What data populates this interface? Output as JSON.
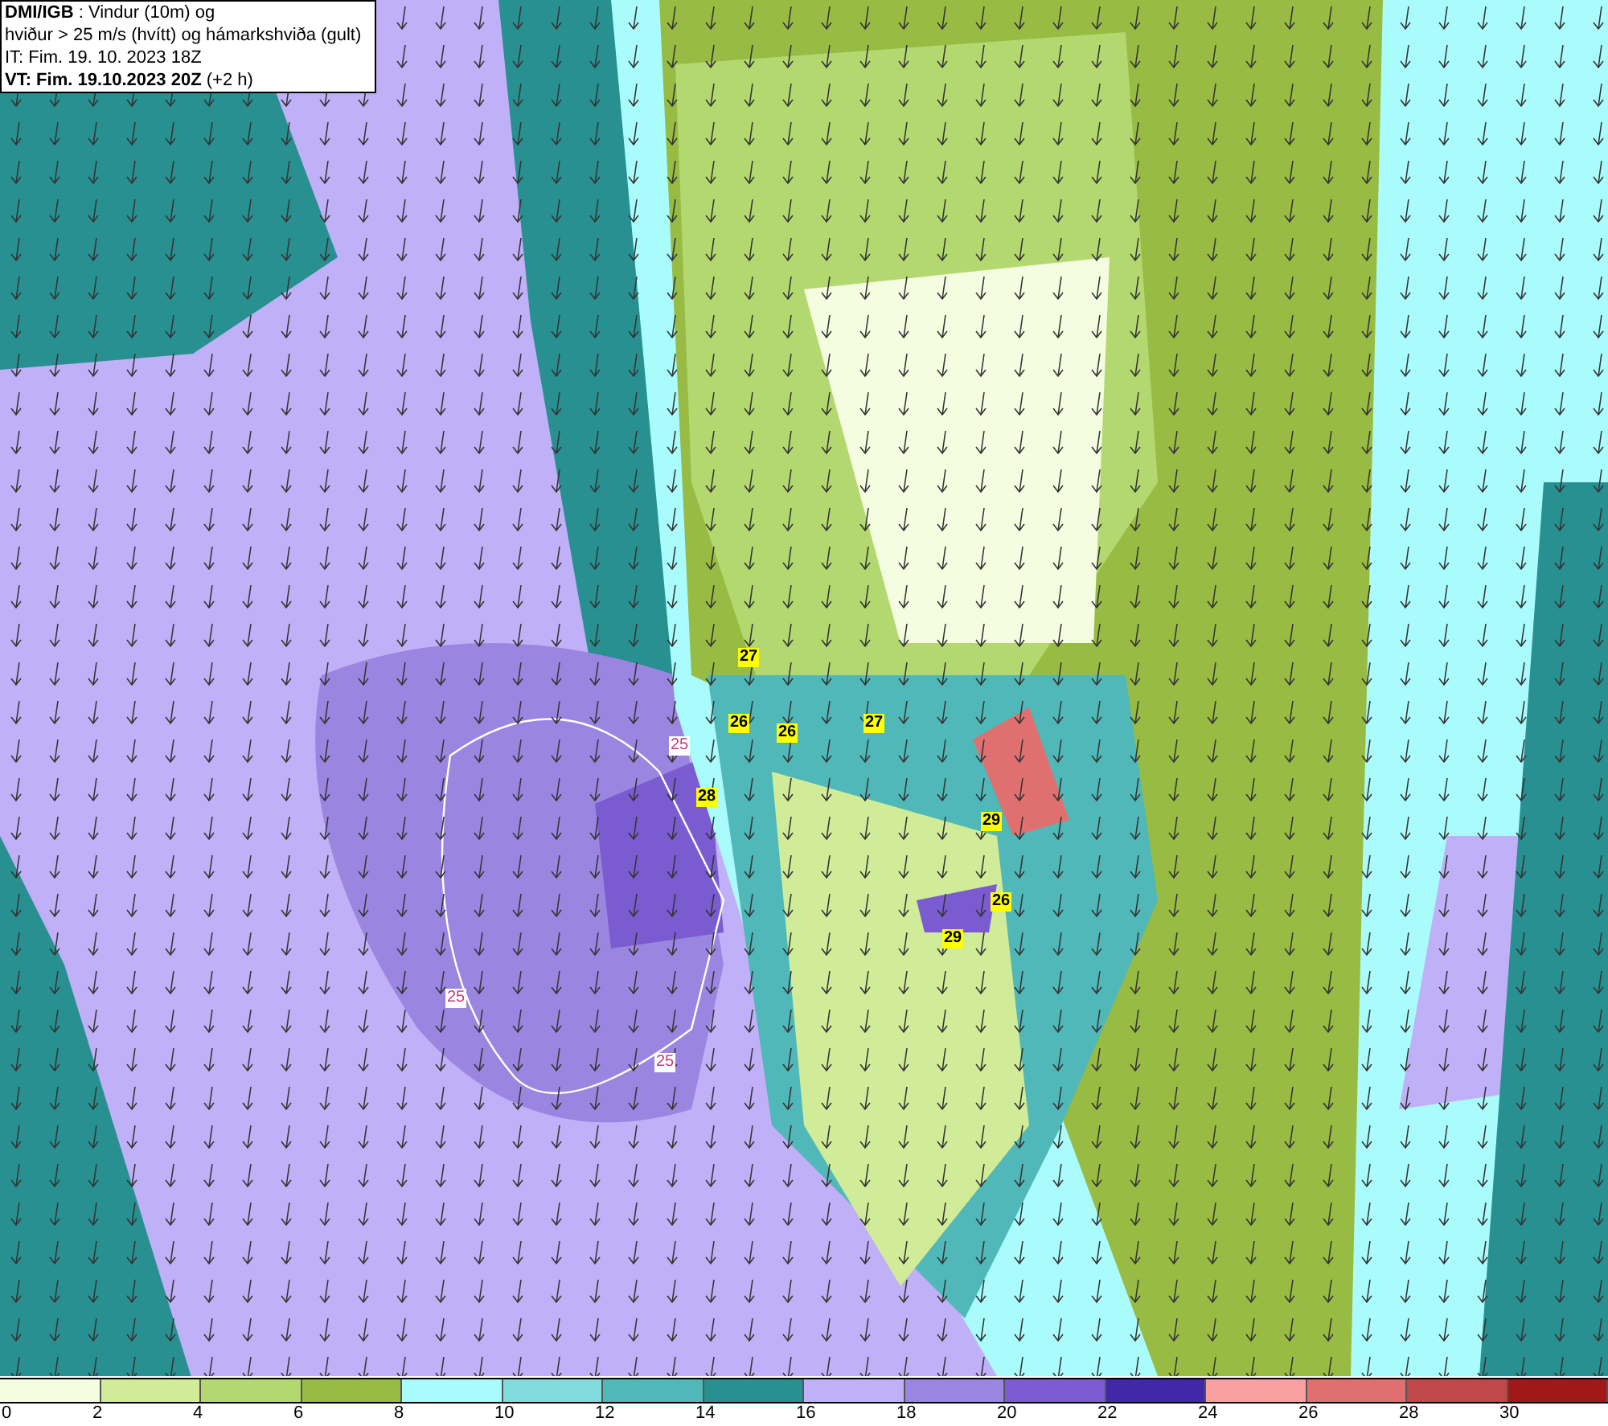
{
  "header": {
    "lines": [
      "**DMI/IGB** : Vindur (10m) og",
      "hviður > 25 m/s (hvítt) og hámarkshviða (gult)",
      "IT: Fim. 19. 10. 2023 18Z",
      "**VT: Fim. 19.10.2023 20Z** (+2 h)"
    ]
  },
  "map": {
    "gust_labels": [
      {
        "text": "27",
        "kind": "max"
      },
      {
        "text": "26",
        "kind": "max"
      },
      {
        "text": "26",
        "kind": "max"
      },
      {
        "text": "27",
        "kind": "max"
      },
      {
        "text": "25",
        "kind": "contour"
      },
      {
        "text": "28",
        "kind": "max"
      },
      {
        "text": "29",
        "kind": "max"
      },
      {
        "text": "26",
        "kind": "max"
      },
      {
        "text": "29",
        "kind": "max"
      },
      {
        "text": "25",
        "kind": "contour"
      },
      {
        "text": "25",
        "kind": "contour"
      }
    ]
  },
  "legend": {
    "swatches": [
      {
        "color": "#f5fde0"
      },
      {
        "color": "#d0ec98"
      },
      {
        "color": "#b4d870"
      },
      {
        "color": "#98bb44"
      },
      {
        "color": "#aafcfc"
      },
      {
        "color": "#80dcdc"
      },
      {
        "color": "#50b8b8"
      },
      {
        "color": "#289090"
      },
      {
        "color": "#c0b0f8"
      },
      {
        "color": "#9a86e0"
      },
      {
        "color": "#7a5cd0"
      },
      {
        "color": "#4028a8"
      },
      {
        "color": "#f8a0a0"
      },
      {
        "color": "#e07070"
      },
      {
        "color": "#c04848"
      },
      {
        "color": "#a01818"
      }
    ],
    "ticks": [
      "0",
      "2",
      "4",
      "6",
      "8",
      "10",
      "12",
      "14",
      "16",
      "18",
      "20",
      "22",
      "24",
      "26",
      "28",
      "30"
    ]
  }
}
